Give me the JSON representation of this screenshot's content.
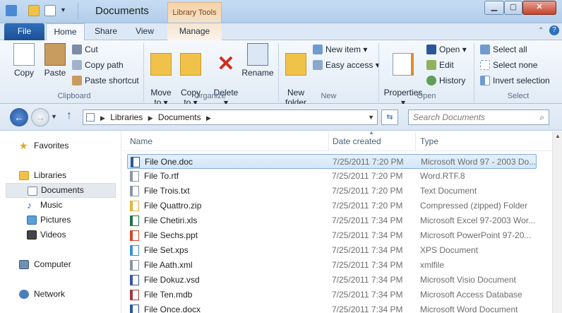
{
  "window": {
    "title": "Documents",
    "contextual_tab": "Library Tools"
  },
  "title_buttons": {
    "minimize": "▁",
    "maximize": "▢",
    "close": "✕"
  },
  "tabs": [
    {
      "label": "File"
    },
    {
      "label": "Home"
    },
    {
      "label": "Share"
    },
    {
      "label": "View"
    },
    {
      "label": "Manage"
    }
  ],
  "ribbon": {
    "clipboard": {
      "label": "Clipboard",
      "copy": "Copy",
      "paste": "Paste",
      "cut": "Cut",
      "copy_path": "Copy path",
      "paste_shortcut": "Paste shortcut"
    },
    "organize": {
      "label": "Organize",
      "move_to": "Move\nto ▾",
      "copy_to": "Copy\nto ▾",
      "delete": "Delete\n▾",
      "rename": "Rename"
    },
    "new": {
      "label": "New",
      "new_folder": "New\nfolder",
      "new_item": "New item ▾",
      "easy_access": "Easy access ▾"
    },
    "open": {
      "label": "Open",
      "properties": "Properties\n▾",
      "open": "Open ▾",
      "edit": "Edit",
      "history": "History"
    },
    "select": {
      "label": "Select",
      "select_all": "Select all",
      "select_none": "Select none",
      "invert_selection": "Invert selection"
    }
  },
  "address": {
    "path": [
      "Libraries",
      "Documents"
    ],
    "search_placeholder": "Search Documents"
  },
  "nav": {
    "items": [
      {
        "label": "Favorites",
        "level": 0,
        "icon": "star-icon"
      },
      {
        "label": "Libraries",
        "level": 0,
        "icon": "libraries-icon"
      },
      {
        "label": "Documents",
        "level": 1,
        "icon": "documents-icon"
      },
      {
        "label": "Music",
        "level": 1,
        "icon": "music-icon"
      },
      {
        "label": "Pictures",
        "level": 1,
        "icon": "pictures-icon"
      },
      {
        "label": "Videos",
        "level": 1,
        "icon": "videos-icon"
      },
      {
        "label": "Computer",
        "level": 0,
        "icon": "computer-icon"
      },
      {
        "label": "Network",
        "level": 0,
        "icon": "network-icon"
      }
    ]
  },
  "columns": {
    "name": "Name",
    "date": "Date created",
    "type": "Type"
  },
  "files": [
    {
      "name": "File One.doc",
      "date": "7/25/2011 7:20 PM",
      "type": "Microsoft Word 97 - 2003 Do...",
      "icon": "word-doc-icon",
      "color": "#2b579a"
    },
    {
      "name": "File To.rtf",
      "date": "7/25/2011 7:20 PM",
      "type": "Word.RTF.8",
      "icon": "rtf-icon",
      "color": "#8a95a4"
    },
    {
      "name": "File Trois.txt",
      "date": "7/25/2011 7:20 PM",
      "type": "Text Document",
      "icon": "txt-icon",
      "color": "#8a95a4"
    },
    {
      "name": "File Quattro.zip",
      "date": "7/25/2011 7:20 PM",
      "type": "Compressed (zipped) Folder",
      "icon": "zip-icon",
      "color": "#e0b63c"
    },
    {
      "name": "File Chetiri.xls",
      "date": "7/25/2011 7:34 PM",
      "type": "Microsoft Excel 97-2003 Wor...",
      "icon": "excel-icon",
      "color": "#217346"
    },
    {
      "name": "File Sechs.ppt",
      "date": "7/25/2011 7:34 PM",
      "type": "Microsoft PowerPoint 97-20...",
      "icon": "ppt-icon",
      "color": "#d24726"
    },
    {
      "name": "File Set.xps",
      "date": "7/25/2011 7:34 PM",
      "type": "XPS Document",
      "icon": "xps-icon",
      "color": "#3f8fd2"
    },
    {
      "name": "File Aath.xml",
      "date": "7/25/2011 7:34 PM",
      "type": "xmlfile",
      "icon": "xml-icon",
      "color": "#8a95a4"
    },
    {
      "name": "File Dokuz.vsd",
      "date": "7/25/2011 7:34 PM",
      "type": "Microsoft Visio Document",
      "icon": "visio-icon",
      "color": "#3955a3"
    },
    {
      "name": "File Ten.mdb",
      "date": "7/25/2011 7:34 PM",
      "type": "Microsoft Access Database",
      "icon": "access-icon",
      "color": "#a4373a"
    },
    {
      "name": "File Once.docx",
      "date": "7/25/2011 7:34 PM",
      "type": "Microsoft Word Document",
      "icon": "word-docx-icon",
      "color": "#2b579a"
    }
  ]
}
